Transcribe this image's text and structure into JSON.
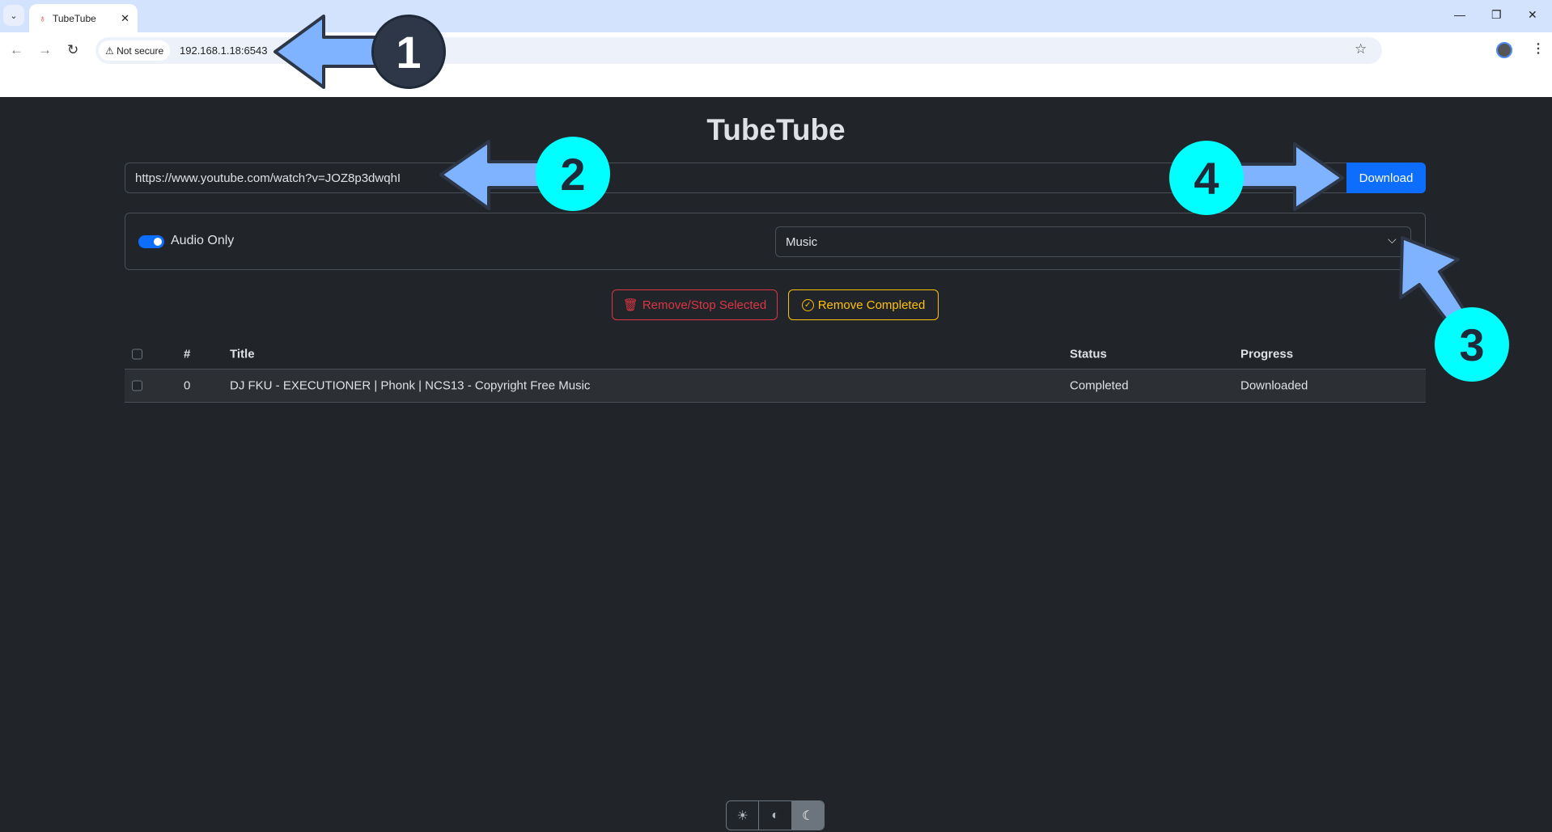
{
  "browser": {
    "tab_title": "TubeTube",
    "security_label": "Not secure",
    "url": "192.168.1.18:6543"
  },
  "app": {
    "title": "TubeTube",
    "url_input_value": "https://www.youtube.com/watch?v=JOZ8p3dwqhI",
    "download_label": "Download",
    "audio_only_label": "Audio Only",
    "audio_only_enabled": true,
    "folder_select_value": "Music",
    "remove_selected_label": "Remove/Stop Selected",
    "remove_completed_label": "Remove Completed"
  },
  "table": {
    "headers": {
      "num": "#",
      "title": "Title",
      "status": "Status",
      "progress": "Progress"
    },
    "rows": [
      {
        "num": "0",
        "title": "DJ FKU - EXECUTIONER | Phonk | NCS13 - Copyright Free Music",
        "status": "Completed",
        "progress": "Downloaded"
      }
    ]
  },
  "theme_switcher": {
    "options": [
      "light",
      "auto",
      "dark"
    ],
    "selected": "dark"
  },
  "annotations": {
    "one": "1",
    "two": "2",
    "three": "3",
    "four": "4"
  },
  "colors": {
    "primary": "#0d6efd",
    "danger": "#dc3545",
    "warning": "#ffc107",
    "background": "#212529",
    "annotation_cyan": "#00ffff",
    "annotation_arrow": "#80b3ff"
  }
}
